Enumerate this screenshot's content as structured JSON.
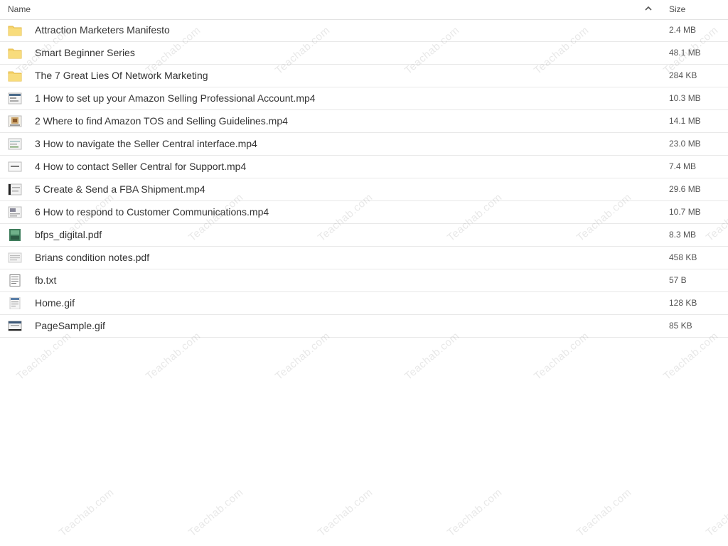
{
  "header": {
    "name_label": "Name",
    "size_label": "Size",
    "sort_icon": "chevron-up-icon"
  },
  "files": [
    {
      "name": "Attraction Marketers Manifesto",
      "size": "2.4 MB",
      "icon": "folder-icon"
    },
    {
      "name": "Smart Beginner Series",
      "size": "48.1 MB",
      "icon": "folder-icon"
    },
    {
      "name": "The 7 Great Lies Of Network Marketing",
      "size": "284 KB",
      "icon": "folder-icon"
    },
    {
      "name": "1 How to set up your Amazon Selling Professional Account.mp4",
      "size": "10.3 MB",
      "icon": "video-thumbnail-icon"
    },
    {
      "name": "2 Where to find Amazon TOS and Selling Guidelines.mp4",
      "size": "14.1 MB",
      "icon": "video-thumbnail-icon"
    },
    {
      "name": "3 How to navigate the Seller Central interface.mp4",
      "size": "23.0 MB",
      "icon": "video-thumbnail-icon"
    },
    {
      "name": "4 How to contact Seller Central for Support.mp4",
      "size": "7.4 MB",
      "icon": "video-thumbnail-icon"
    },
    {
      "name": "5 Create & Send a FBA Shipment.mp4",
      "size": "29.6 MB",
      "icon": "video-thumbnail-icon"
    },
    {
      "name": "6 How to respond to Customer Communications.mp4",
      "size": "10.7 MB",
      "icon": "video-thumbnail-icon"
    },
    {
      "name": "bfps_digital.pdf",
      "size": "8.3 MB",
      "icon": "pdf-thumbnail-icon"
    },
    {
      "name": "Brians condition notes.pdf",
      "size": "458 KB",
      "icon": "pdf-thumbnail-icon"
    },
    {
      "name": "fb.txt",
      "size": "57 B",
      "icon": "text-file-icon"
    },
    {
      "name": "Home.gif",
      "size": "128 KB",
      "icon": "image-thumbnail-icon"
    },
    {
      "name": "PageSample.gif",
      "size": "85 KB",
      "icon": "image-thumbnail-icon"
    }
  ],
  "watermark_text": "Teachab.com",
  "colors": {
    "folder": "#f5d36b",
    "folder_dark": "#e7bd45",
    "divider": "#e8e8e8"
  }
}
